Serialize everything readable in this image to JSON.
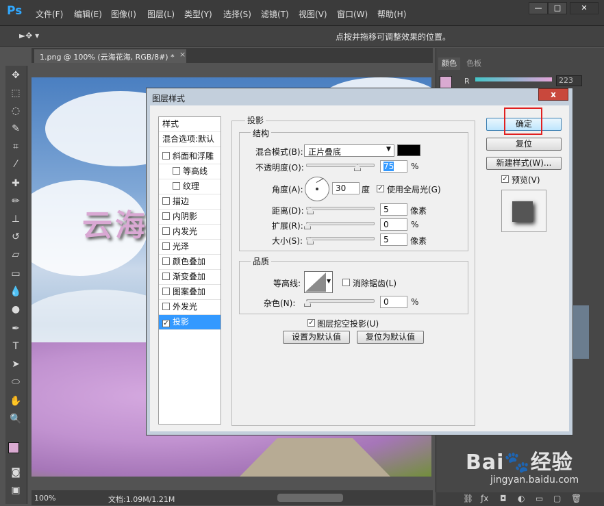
{
  "app": {
    "logo": "Ps"
  },
  "menu": [
    "文件(F)",
    "编辑(E)",
    "图像(I)",
    "图层(L)",
    "类型(Y)",
    "选择(S)",
    "滤镜(T)",
    "视图(V)",
    "窗口(W)",
    "帮助(H)"
  ],
  "window_controls": {
    "minimize": "—",
    "maximize": "□",
    "close": "✕"
  },
  "options_bar": {
    "tool_icon": "move-arrow-icon",
    "hint": "点按并拖移可调整效果的位置。"
  },
  "document": {
    "tab": "1.png @ 100% (云海花海, RGB/8#) *",
    "tab_close": "×",
    "canvas_text": "云海",
    "status_zoom": "100%",
    "status_doc": "文档:1.09M/1.21M"
  },
  "panels": {
    "color_tab": "颜色",
    "swatch_tab": "色板",
    "r_label": "R",
    "r_value": "223"
  },
  "dialog": {
    "title": "图层样式",
    "close": "x",
    "styles_header": "样式",
    "blending_default": "混合选项:默认",
    "style_items": [
      {
        "label": "斜面和浮雕",
        "checked": false,
        "indent": false
      },
      {
        "label": "等高线",
        "checked": false,
        "indent": true
      },
      {
        "label": "纹理",
        "checked": false,
        "indent": true
      },
      {
        "label": "描边",
        "checked": false,
        "indent": false
      },
      {
        "label": "内阴影",
        "checked": false,
        "indent": false
      },
      {
        "label": "内发光",
        "checked": false,
        "indent": false
      },
      {
        "label": "光泽",
        "checked": false,
        "indent": false
      },
      {
        "label": "颜色叠加",
        "checked": false,
        "indent": false
      },
      {
        "label": "渐变叠加",
        "checked": false,
        "indent": false
      },
      {
        "label": "图案叠加",
        "checked": false,
        "indent": false
      },
      {
        "label": "外发光",
        "checked": false,
        "indent": false
      },
      {
        "label": "投影",
        "checked": true,
        "indent": false,
        "selected": true
      }
    ],
    "drop_shadow": {
      "section": "投影",
      "structure": "结构",
      "blend_mode_label": "混合模式(B):",
      "blend_mode": "正片叠底",
      "shadow_color": "#000000",
      "opacity_label": "不透明度(O):",
      "opacity": "75",
      "opacity_unit": "%",
      "opacity_level": 0.75,
      "angle_label": "角度(A):",
      "angle": "30",
      "angle_unit": "度",
      "global_light": "使用全局光(G)",
      "global_light_checked": true,
      "distance_label": "距离(D):",
      "distance": "5",
      "distance_unit": "像素",
      "spread_label": "扩展(R):",
      "spread": "0",
      "spread_unit": "%",
      "size_label": "大小(S):",
      "size": "5",
      "size_unit": "像素",
      "quality": "品质",
      "contour_label": "等高线:",
      "antialias": "消除锯齿(L)",
      "antialias_checked": false,
      "noise_label": "杂色(N):",
      "noise": "0",
      "noise_unit": "%",
      "knockout": "图层挖空投影(U)",
      "knockout_checked": true,
      "make_default": "设置为默认值",
      "reset_default": "复位为默认值"
    },
    "buttons": {
      "ok": "确定",
      "reset": "复位",
      "new_style": "新建样式(W)...",
      "preview": "预览(V)",
      "preview_checked": true
    }
  },
  "watermark": {
    "text": "Bai🐾经验",
    "url": "jingyan.baidu.com"
  },
  "colors": {
    "accent": "#3399ff",
    "highlight": "#e02020",
    "fg_swatch": "#d9aad1"
  }
}
